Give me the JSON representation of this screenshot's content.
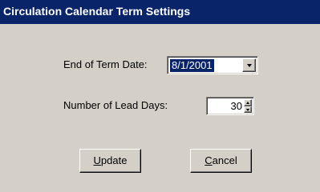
{
  "window": {
    "title": "Circulation Calendar Term Settings"
  },
  "form": {
    "end_of_term_label": "End of Term  Date:",
    "end_of_term_value": "8/1/2001",
    "lead_days_label": "Number of Lead Days:",
    "lead_days_value": "30"
  },
  "buttons": {
    "update": {
      "mnemonic": "U",
      "rest": "pdate"
    },
    "cancel": {
      "mnemonic": "C",
      "rest": "ancel"
    }
  },
  "colors": {
    "title_bar": "#0a246a",
    "face": "#d4d0c8",
    "selection": "#0a246a"
  }
}
